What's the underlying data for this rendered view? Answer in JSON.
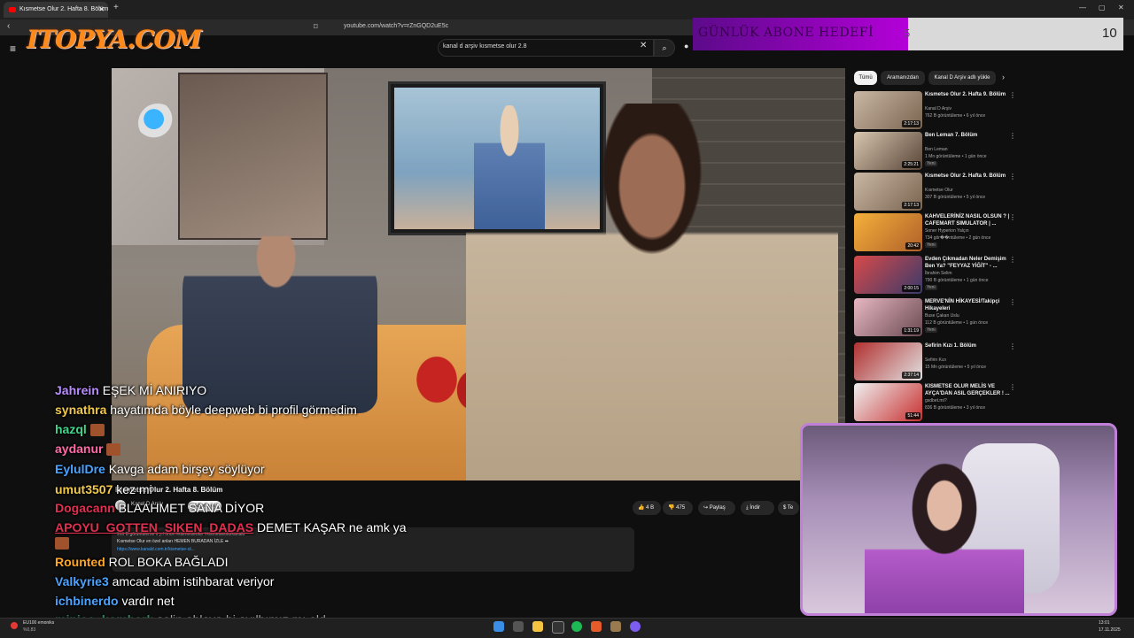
{
  "browser": {
    "tab_title": "Kısmetse Olur 2. Hafta 8. Bölüm",
    "url": "youtube.com/watch?v=rZnGQD2uE5c"
  },
  "overlay": {
    "logo_text": "ITOPYA.COM",
    "goal_label": "GÜNLÜK ABONE HEDEFİ",
    "goal_current": "5",
    "goal_target": "10",
    "goal_progress": 0.5
  },
  "search": {
    "query": "kanal d arşiv kısmetse olur 2.8"
  },
  "video": {
    "title": "Kısmetse Olur 2. Hafta 8. Bölüm",
    "channel": "Kanal D Arşiv",
    "subscribe_label": "Abone ol",
    "likes": "4 B",
    "dislikes": "475",
    "share_label": "Paylaş",
    "download_label": "İndir",
    "teşekkür_label": "Te",
    "desc_meta": "910 B görüntüleme   6 yıl önce  #kismetseolur #kismetseolurkanald",
    "desc_line": "Kısmetse Olur en özel anları HEMEN BURADAN İZLE ➡",
    "desc_link": "https://www.kanald.com.tr/kismetse-ol..."
  },
  "sidebar": {
    "chips": [
      "Tümü",
      "Aramanızdan",
      "Kanal D Arşiv adlı yükle"
    ],
    "recommendations": [
      {
        "title": "Kısmetse Olur 2. Hafta 9. Bölüm",
        "channel": "Kanal D Arşiv",
        "meta": "762 B görüntüleme • 6 yıl önce",
        "duration": "2:17:13",
        "badge": ""
      },
      {
        "title": "Ben Leman 7. Bölüm",
        "channel": "Ben Leman",
        "meta": "1 Mn görüntüleme • 1 gün önce",
        "duration": "2:25:21",
        "badge": "Yeni"
      },
      {
        "title": "Kısmetse Olur 2. Hafta 9. Bölüm",
        "channel": "Kısmetse Olur",
        "meta": "307 B görüntüleme • 5 yıl önce",
        "duration": "2:17:13",
        "badge": ""
      },
      {
        "title": "KAHVELERİNİZ NASIL OLSUN ? | CAFEMART SIMULATOR | ...",
        "channel": "Soner Hyperion Yalçın",
        "meta": "734 gör��ntüleme • 2 gün önce",
        "duration": "20:42",
        "badge": "Yeni"
      },
      {
        "title": "Evden Çıkmadan Neler Demişim Ben Ya? \"FEYYAZ YİĞİT\" - ...",
        "channel": "İbrahim Selim",
        "meta": "790 B görüntüleme • 1 gün önce",
        "duration": "2:00:15",
        "badge": "Yeni"
      },
      {
        "title": "MERVE'NİN HİKAYESİ/Takipçi Hikayeleri",
        "channel": "Buse Çakan Uslu",
        "meta": "112 B görüntüleme • 1 gün önce",
        "duration": "1:31:19",
        "badge": "Yeni"
      },
      {
        "title": "Sefirin Kızı 1. Bölüm",
        "channel": "Sefirin Kızı",
        "meta": "15 Mn görüntüleme • 5 yıl önce",
        "duration": "2:37:14",
        "badge": ""
      },
      {
        "title": "KISMETSE OLUR MELİS VE AYÇA'DAN ASIL GERÇEKLER ! ...",
        "channel": "gsdbet.mt?",
        "meta": "836 B görüntüleme • 3 yıl önce",
        "duration": "51:44",
        "badge": ""
      }
    ]
  },
  "chat": [
    {
      "user": "Jahrein",
      "color": "#b98cff",
      "text": "EŞEK Mİ ANIRIYO",
      "emote": false
    },
    {
      "user": "synathra",
      "color": "#f2c94c",
      "text": "hayatımda böyle deepweb bi profil görmedim",
      "emote": false
    },
    {
      "user": "hazql",
      "color": "#3fd68b",
      "text": "",
      "emote": true
    },
    {
      "user": "aydanur",
      "color": "#ff6ba8",
      "text": "",
      "emote": true
    },
    {
      "user": "EylulDre",
      "color": "#4aa3ff",
      "text": "Kavga adam birşey söylüyor",
      "emote": false
    },
    {
      "user": "umut3507",
      "color": "#f2c94c",
      "text": "kez mi",
      "emote": false
    },
    {
      "user": "Dogacann",
      "color": "#e0304f",
      "text": "BLAAHMET SANA DİYOR",
      "emote": false
    },
    {
      "user": "APOYU_GOTTEN_SIKEN_DADAS",
      "color": "#e0304f",
      "text": "DEMET KAŞAR ne amk ya",
      "emote": false
    },
    {
      "user": "Rounted",
      "color": "#ffa726",
      "text": "ROL BOKA BAĞLADI",
      "emote": false
    },
    {
      "user": "Valkyrie3",
      "color": "#4aa3ff",
      "text": "amcad abim istihbarat veriyor",
      "emote": false
    },
    {
      "user": "ichbinerdo",
      "color": "#4aa3ff",
      "text": "vardır net",
      "emote": false
    },
    {
      "user": "minico_kombarlı",
      "color": "#3fd68b",
      "text": "selin ablaya bi ayılbımız mı old",
      "emote": false
    }
  ],
  "taskbar": {
    "weather_temp": "EU100 emoniks",
    "weather_sub": "%0,83",
    "time": "13:01",
    "date": "17.11.2025"
  }
}
